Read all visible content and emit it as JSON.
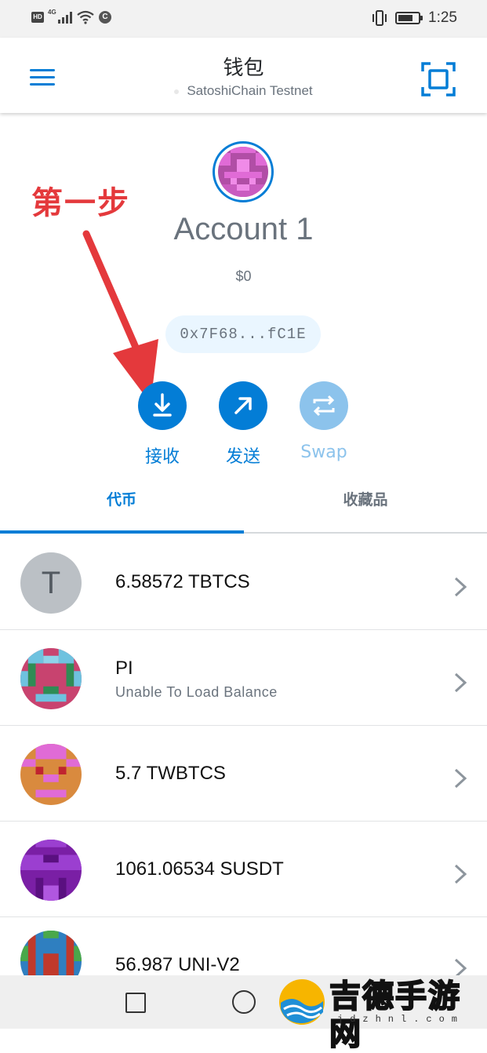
{
  "status_bar": {
    "hd": "HD",
    "network_type": "4G",
    "vpn_badge": "C",
    "time": "1:25",
    "battery_level": 0.75
  },
  "header": {
    "title": "钱包",
    "network": "SatoshiChain Testnet",
    "menu_icon": "hamburger-menu-icon",
    "scan_icon": "qr-scan-icon"
  },
  "account": {
    "name": "Account 1",
    "fiat_balance": "$0",
    "address": "0x7F68...fC1E"
  },
  "annotation": {
    "text": "第一步",
    "color": "#e4393c"
  },
  "actions": [
    {
      "label": "接收",
      "icon": "download-icon",
      "enabled": true
    },
    {
      "label": "发送",
      "icon": "arrow-up-right-icon",
      "enabled": true
    },
    {
      "label": "Swap",
      "icon": "swap-arrows-icon",
      "enabled": false
    }
  ],
  "tabs": [
    {
      "label": "代币",
      "active": true
    },
    {
      "label": "收藏品",
      "active": false
    }
  ],
  "tokens": [
    {
      "amount": "6.58572 TBTCS",
      "icon_letter": "T",
      "sub": ""
    },
    {
      "amount": "PI",
      "sub": "Unable To Load Balance"
    },
    {
      "amount": "5.7 TWBTCS",
      "sub": ""
    },
    {
      "amount": "1061.06534 SUSDT",
      "sub": ""
    },
    {
      "amount": "56.987 UNI-V2",
      "sub": ""
    }
  ],
  "watermark": {
    "text": "吉德手游网",
    "url": "jdzhnl.com"
  },
  "colors": {
    "accent": "#037dd6",
    "accent_disabled": "#8cc3ec",
    "muted_text": "#6a737d",
    "address_bg": "#eaf6ff"
  }
}
